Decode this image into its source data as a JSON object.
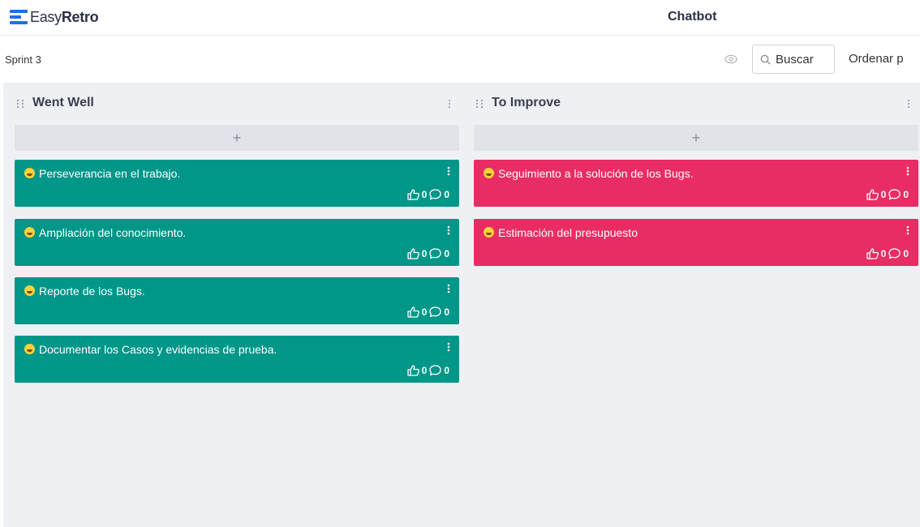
{
  "app": {
    "logo_regular": "Easy",
    "logo_bold": "Retro",
    "board_title": "Chatbot"
  },
  "subbar": {
    "sprint": "Sprint 3",
    "search_placeholder": "Buscar",
    "sort_label": "Ordenar p"
  },
  "columns": [
    {
      "title": "Went Well",
      "add_label": "+",
      "color": "#009688",
      "cards": [
        {
          "text": "Perseverancia en el trabajo.",
          "votes": "0",
          "comments": "0"
        },
        {
          "text": "Ampliación del conocimiento.",
          "votes": "0",
          "comments": "0"
        },
        {
          "text": "Reporte de los Bugs.",
          "votes": "0",
          "comments": "0"
        },
        {
          "text": "Documentar los Casos y evidencias de prueba.",
          "votes": "0",
          "comments": "0"
        }
      ]
    },
    {
      "title": "To Improve",
      "add_label": "+",
      "color": "#e92c63",
      "cards": [
        {
          "text": "Seguimiento a la solución de los Bugs.",
          "votes": "0",
          "comments": "0"
        },
        {
          "text": "Estimación del presupuesto",
          "votes": "0",
          "comments": "0"
        }
      ]
    }
  ],
  "icons": [
    "logo-icon",
    "eye-icon",
    "search-icon",
    "drag-handle-icon",
    "more-vertical-icon",
    "emoji-icon",
    "thumbs-up-icon",
    "comment-icon"
  ]
}
